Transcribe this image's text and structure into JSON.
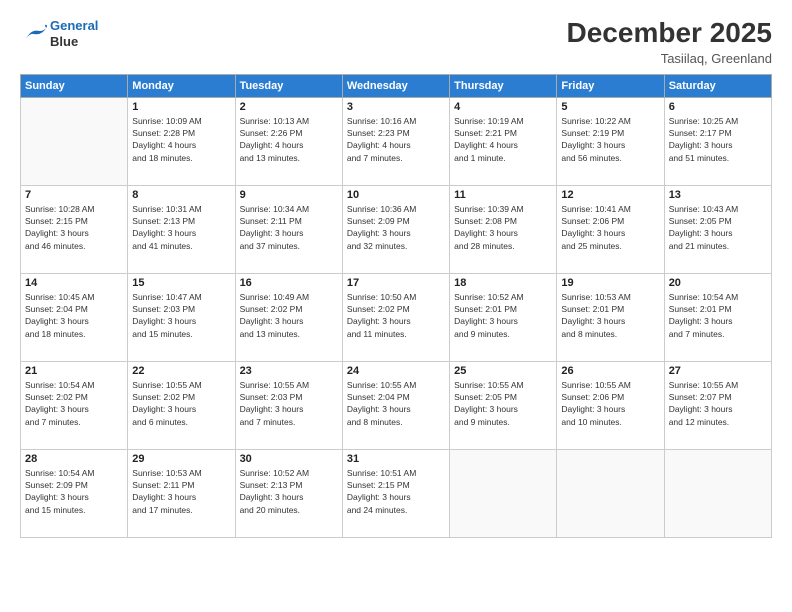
{
  "header": {
    "logo_line1": "General",
    "logo_line2": "Blue",
    "month_title": "December 2025",
    "location": "Tasiilaq, Greenland"
  },
  "weekdays": [
    "Sunday",
    "Monday",
    "Tuesday",
    "Wednesday",
    "Thursday",
    "Friday",
    "Saturday"
  ],
  "weeks": [
    [
      {
        "day": "",
        "info": ""
      },
      {
        "day": "1",
        "info": "Sunrise: 10:09 AM\nSunset: 2:28 PM\nDaylight: 4 hours\nand 18 minutes."
      },
      {
        "day": "2",
        "info": "Sunrise: 10:13 AM\nSunset: 2:26 PM\nDaylight: 4 hours\nand 13 minutes."
      },
      {
        "day": "3",
        "info": "Sunrise: 10:16 AM\nSunset: 2:23 PM\nDaylight: 4 hours\nand 7 minutes."
      },
      {
        "day": "4",
        "info": "Sunrise: 10:19 AM\nSunset: 2:21 PM\nDaylight: 4 hours\nand 1 minute."
      },
      {
        "day": "5",
        "info": "Sunrise: 10:22 AM\nSunset: 2:19 PM\nDaylight: 3 hours\nand 56 minutes."
      },
      {
        "day": "6",
        "info": "Sunrise: 10:25 AM\nSunset: 2:17 PM\nDaylight: 3 hours\nand 51 minutes."
      }
    ],
    [
      {
        "day": "7",
        "info": "Sunrise: 10:28 AM\nSunset: 2:15 PM\nDaylight: 3 hours\nand 46 minutes."
      },
      {
        "day": "8",
        "info": "Sunrise: 10:31 AM\nSunset: 2:13 PM\nDaylight: 3 hours\nand 41 minutes."
      },
      {
        "day": "9",
        "info": "Sunrise: 10:34 AM\nSunset: 2:11 PM\nDaylight: 3 hours\nand 37 minutes."
      },
      {
        "day": "10",
        "info": "Sunrise: 10:36 AM\nSunset: 2:09 PM\nDaylight: 3 hours\nand 32 minutes."
      },
      {
        "day": "11",
        "info": "Sunrise: 10:39 AM\nSunset: 2:08 PM\nDaylight: 3 hours\nand 28 minutes."
      },
      {
        "day": "12",
        "info": "Sunrise: 10:41 AM\nSunset: 2:06 PM\nDaylight: 3 hours\nand 25 minutes."
      },
      {
        "day": "13",
        "info": "Sunrise: 10:43 AM\nSunset: 2:05 PM\nDaylight: 3 hours\nand 21 minutes."
      }
    ],
    [
      {
        "day": "14",
        "info": "Sunrise: 10:45 AM\nSunset: 2:04 PM\nDaylight: 3 hours\nand 18 minutes."
      },
      {
        "day": "15",
        "info": "Sunrise: 10:47 AM\nSunset: 2:03 PM\nDaylight: 3 hours\nand 15 minutes."
      },
      {
        "day": "16",
        "info": "Sunrise: 10:49 AM\nSunset: 2:02 PM\nDaylight: 3 hours\nand 13 minutes."
      },
      {
        "day": "17",
        "info": "Sunrise: 10:50 AM\nSunset: 2:02 PM\nDaylight: 3 hours\nand 11 minutes."
      },
      {
        "day": "18",
        "info": "Sunrise: 10:52 AM\nSunset: 2:01 PM\nDaylight: 3 hours\nand 9 minutes."
      },
      {
        "day": "19",
        "info": "Sunrise: 10:53 AM\nSunset: 2:01 PM\nDaylight: 3 hours\nand 8 minutes."
      },
      {
        "day": "20",
        "info": "Sunrise: 10:54 AM\nSunset: 2:01 PM\nDaylight: 3 hours\nand 7 minutes."
      }
    ],
    [
      {
        "day": "21",
        "info": "Sunrise: 10:54 AM\nSunset: 2:02 PM\nDaylight: 3 hours\nand 7 minutes."
      },
      {
        "day": "22",
        "info": "Sunrise: 10:55 AM\nSunset: 2:02 PM\nDaylight: 3 hours\nand 6 minutes."
      },
      {
        "day": "23",
        "info": "Sunrise: 10:55 AM\nSunset: 2:03 PM\nDaylight: 3 hours\nand 7 minutes."
      },
      {
        "day": "24",
        "info": "Sunrise: 10:55 AM\nSunset: 2:04 PM\nDaylight: 3 hours\nand 8 minutes."
      },
      {
        "day": "25",
        "info": "Sunrise: 10:55 AM\nSunset: 2:05 PM\nDaylight: 3 hours\nand 9 minutes."
      },
      {
        "day": "26",
        "info": "Sunrise: 10:55 AM\nSunset: 2:06 PM\nDaylight: 3 hours\nand 10 minutes."
      },
      {
        "day": "27",
        "info": "Sunrise: 10:55 AM\nSunset: 2:07 PM\nDaylight: 3 hours\nand 12 minutes."
      }
    ],
    [
      {
        "day": "28",
        "info": "Sunrise: 10:54 AM\nSunset: 2:09 PM\nDaylight: 3 hours\nand 15 minutes."
      },
      {
        "day": "29",
        "info": "Sunrise: 10:53 AM\nSunset: 2:11 PM\nDaylight: 3 hours\nand 17 minutes."
      },
      {
        "day": "30",
        "info": "Sunrise: 10:52 AM\nSunset: 2:13 PM\nDaylight: 3 hours\nand 20 minutes."
      },
      {
        "day": "31",
        "info": "Sunrise: 10:51 AM\nSunset: 2:15 PM\nDaylight: 3 hours\nand 24 minutes."
      },
      {
        "day": "",
        "info": ""
      },
      {
        "day": "",
        "info": ""
      },
      {
        "day": "",
        "info": ""
      }
    ]
  ]
}
